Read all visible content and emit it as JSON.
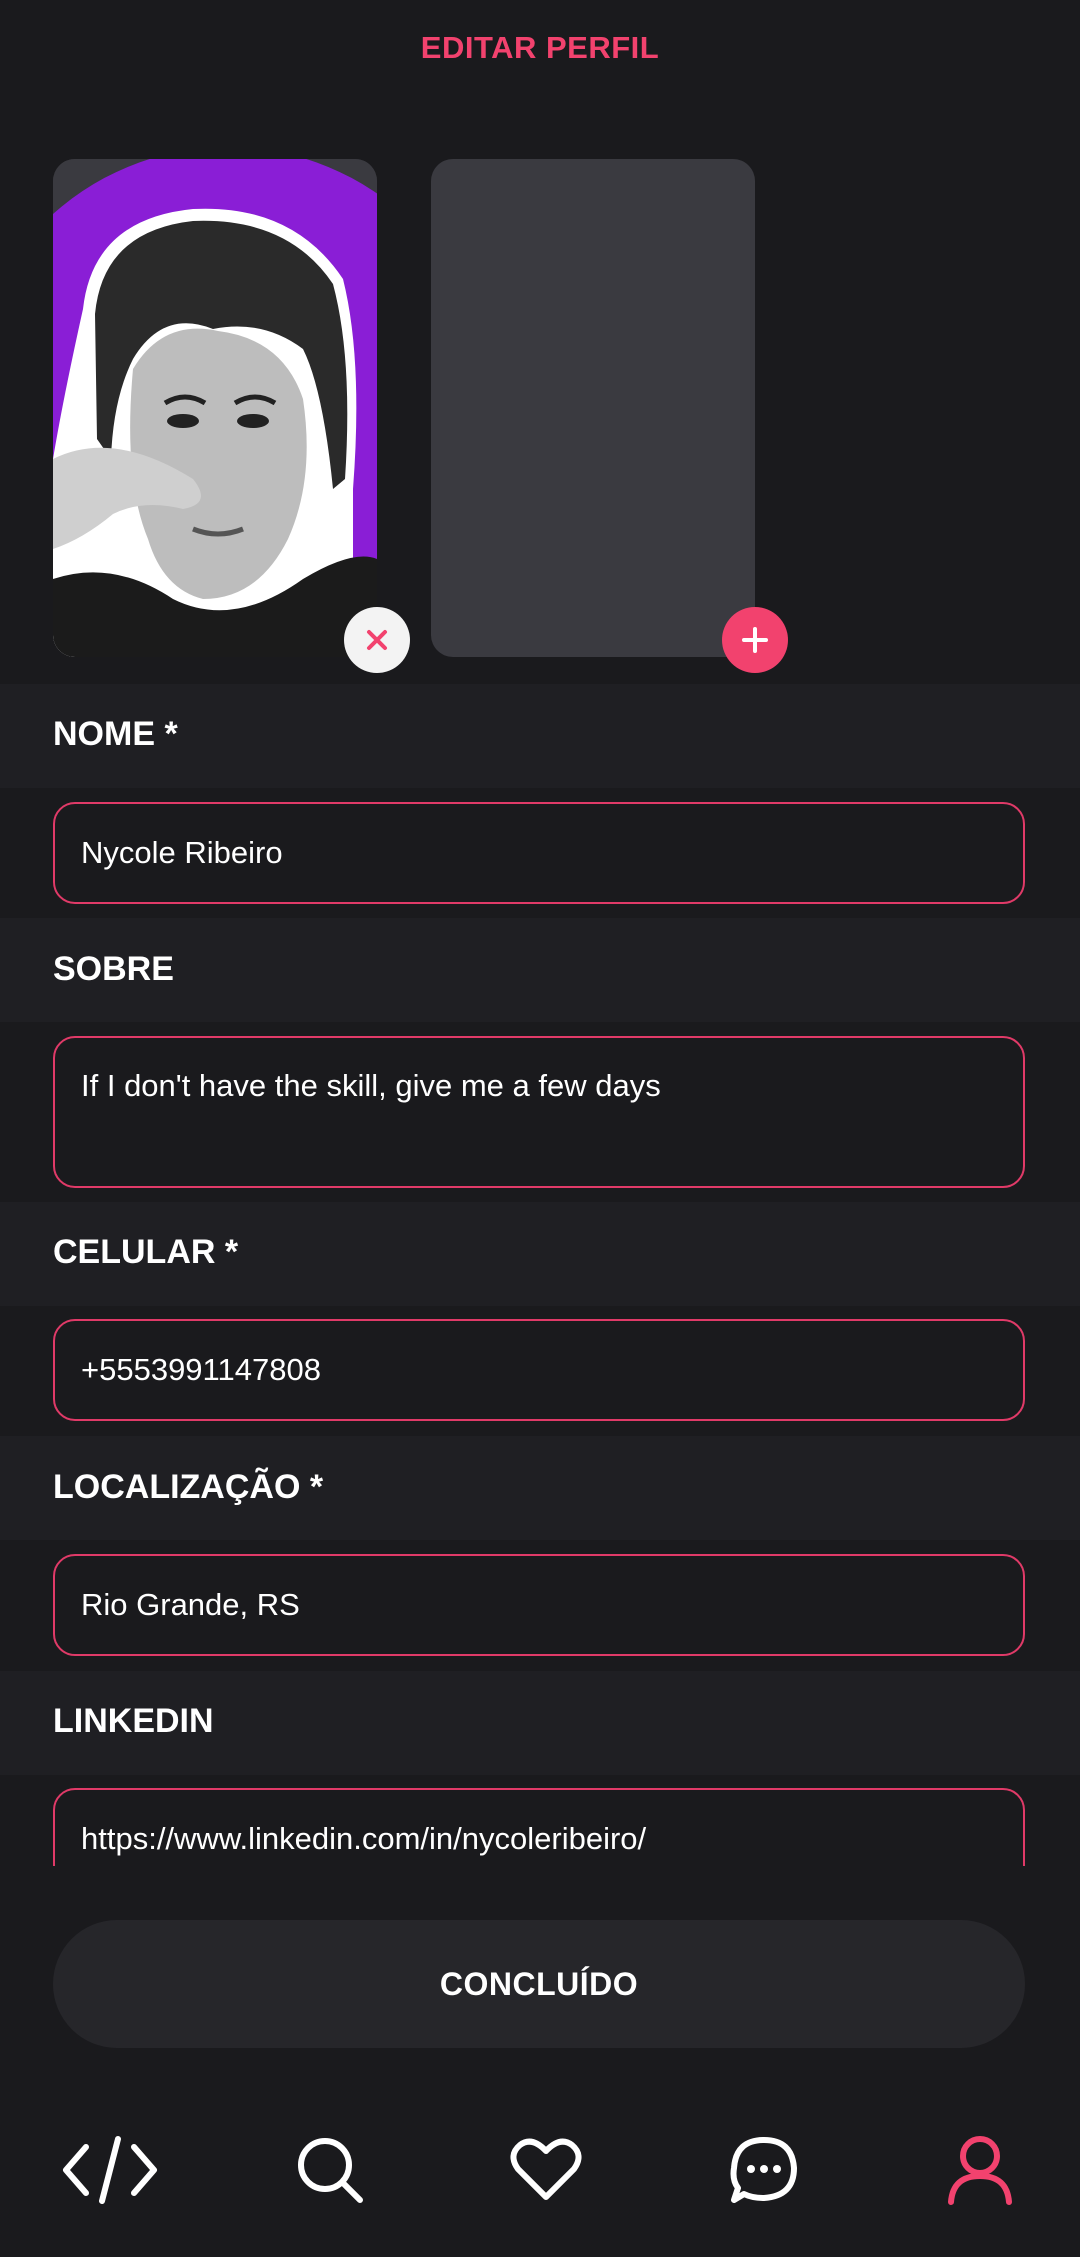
{
  "header": {
    "title": "EDITAR PERFIL"
  },
  "photos": {
    "first_alt": "profile-photo",
    "remove_icon": "close-icon",
    "add_icon": "plus-icon"
  },
  "form": {
    "name_label": "NOME *",
    "name_value": "Nycole Ribeiro",
    "about_label": "SOBRE",
    "about_value": "If I don't have the skill, give me a few days",
    "phone_label": "CELULAR *",
    "phone_value": "+5553991147808",
    "location_label": "LOCALIZAÇÃO *",
    "location_value": "Rio Grande, RS",
    "linkedin_label": "LINKEDIN",
    "linkedin_value": "https://www.linkedin.com/in/nycoleribeiro/"
  },
  "actions": {
    "done_label": "CONCLUÍDO"
  },
  "nav": {
    "items": [
      {
        "icon": "code-icon"
      },
      {
        "icon": "search-icon"
      },
      {
        "icon": "heart-icon"
      },
      {
        "icon": "chat-icon"
      },
      {
        "icon": "user-icon",
        "active": true
      }
    ]
  },
  "colors": {
    "accent": "#f2426e",
    "background": "#1a1a1d",
    "band": "#1f1f23",
    "card": "#3a3a40",
    "photo_bg": "#8a1ed6"
  }
}
